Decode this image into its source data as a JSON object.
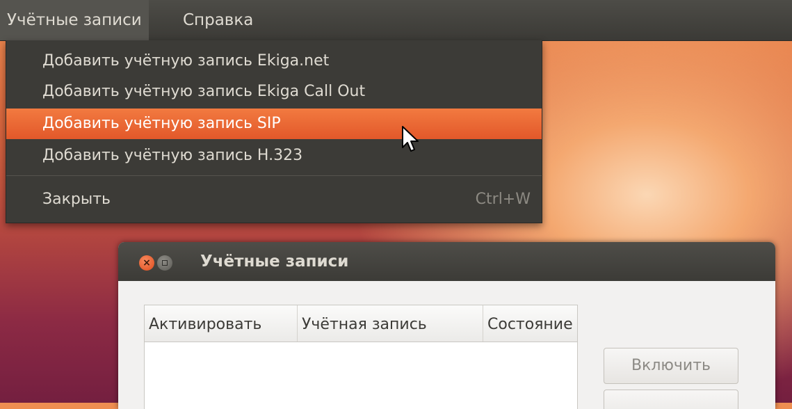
{
  "menubar": {
    "items": [
      {
        "label": "Учётные записи"
      },
      {
        "label": "Справка"
      }
    ]
  },
  "dropdown": {
    "items": [
      {
        "label": "Добавить учётную запись Ekiga.net"
      },
      {
        "label": "Добавить учётную запись Ekiga Call Out"
      },
      {
        "label": "Добавить учётную запись SIP"
      },
      {
        "label": "Добавить учётную запись H.323"
      }
    ],
    "close": {
      "label": "Закрыть",
      "accel": "Ctrl+W"
    },
    "highlighted_index": 2
  },
  "window": {
    "title": "Учётные записи",
    "columns": [
      "Активировать",
      "Учётная запись",
      "Состояние"
    ],
    "buttons": {
      "enable": "Включить"
    }
  },
  "colors": {
    "highlight": "#e95f2e",
    "menu_bg": "#3c3b37",
    "close_button": "#df4b1c"
  },
  "icons": {
    "close": "close-icon",
    "minimize": "minimize-icon",
    "cursor": "mouse-pointer-icon"
  }
}
